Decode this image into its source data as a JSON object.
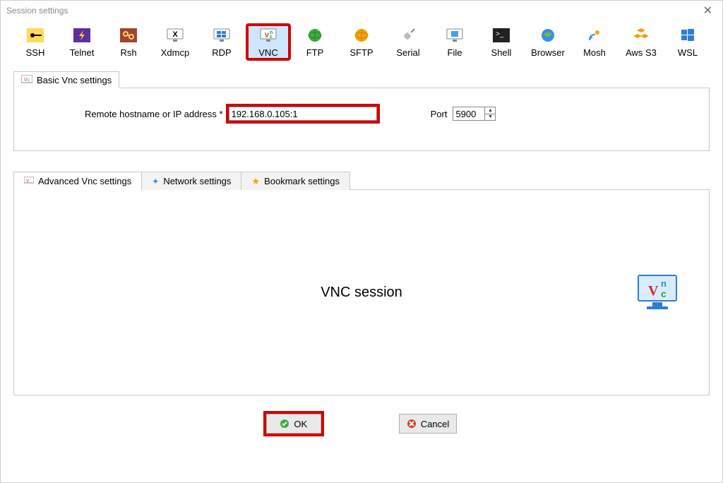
{
  "window": {
    "title": "Session settings"
  },
  "session_types": [
    {
      "id": "ssh",
      "label": "SSH"
    },
    {
      "id": "telnet",
      "label": "Telnet"
    },
    {
      "id": "rsh",
      "label": "Rsh"
    },
    {
      "id": "xdmcp",
      "label": "Xdmcp"
    },
    {
      "id": "rdp",
      "label": "RDP"
    },
    {
      "id": "vnc",
      "label": "VNC",
      "selected": true
    },
    {
      "id": "ftp",
      "label": "FTP"
    },
    {
      "id": "sftp",
      "label": "SFTP"
    },
    {
      "id": "serial",
      "label": "Serial"
    },
    {
      "id": "file",
      "label": "File"
    },
    {
      "id": "shell",
      "label": "Shell"
    },
    {
      "id": "browser",
      "label": "Browser"
    },
    {
      "id": "mosh",
      "label": "Mosh"
    },
    {
      "id": "awss3",
      "label": "Aws S3"
    },
    {
      "id": "wsl",
      "label": "WSL"
    }
  ],
  "basic_tab": {
    "title": "Basic Vnc settings",
    "host_label": "Remote hostname or IP address *",
    "host_value": "192.168.0.105:1",
    "port_label": "Port",
    "port_value": "5900"
  },
  "adv_tabs": [
    {
      "id": "adv-vnc",
      "label": "Advanced Vnc settings"
    },
    {
      "id": "network",
      "label": "Network settings"
    },
    {
      "id": "bookmark",
      "label": "Bookmark settings"
    }
  ],
  "main_caption": "VNC session",
  "buttons": {
    "ok": "OK",
    "cancel": "Cancel"
  }
}
